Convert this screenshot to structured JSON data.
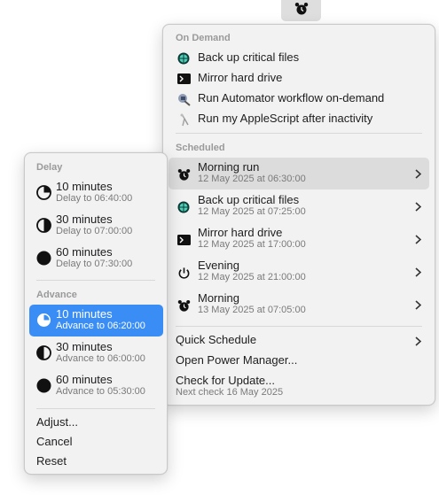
{
  "menubar": {
    "icon": "alarm-clock-icon"
  },
  "main_menu": {
    "on_demand": {
      "header": "On Demand",
      "items": [
        {
          "label": "Back up critical files",
          "icon": "globe-icon"
        },
        {
          "label": "Mirror hard drive",
          "icon": "terminal-icon"
        },
        {
          "label": "Run Automator workflow on-demand",
          "icon": "automator-icon"
        },
        {
          "label": "Run my AppleScript after inactivity",
          "icon": "applescript-icon"
        }
      ]
    },
    "scheduled": {
      "header": "Scheduled",
      "items": [
        {
          "label": "Morning run",
          "sub": "12 May 2025 at 06:30:00",
          "icon": "alarm-clock-icon"
        },
        {
          "label": "Back up critical files",
          "sub": "12 May 2025 at 07:25:00",
          "icon": "globe-icon"
        },
        {
          "label": "Mirror hard drive",
          "sub": "12 May 2025 at 17:00:00",
          "icon": "terminal-icon"
        },
        {
          "label": "Evening",
          "sub": "12 May 2025 at 21:00:00",
          "icon": "power-icon"
        },
        {
          "label": "Morning",
          "sub": "13 May 2025 at 07:05:00",
          "icon": "alarm-clock-icon"
        }
      ]
    },
    "footer": {
      "quick_schedule": "Quick Schedule",
      "open_power_manager": "Open Power Manager...",
      "check_update": "Check for Update...",
      "next_check": "Next check 16 May 2025"
    }
  },
  "sub_menu": {
    "delay": {
      "header": "Delay",
      "items": [
        {
          "label": "10 minutes",
          "sub": "Delay to 06:40:00",
          "icon": "clock-quarter-icon"
        },
        {
          "label": "30 minutes",
          "sub": "Delay to 07:00:00",
          "icon": "clock-half-icon"
        },
        {
          "label": "60 minutes",
          "sub": "Delay to 07:30:00",
          "icon": "clock-full-icon"
        }
      ]
    },
    "advance": {
      "header": "Advance",
      "items": [
        {
          "label": "10 minutes",
          "sub": "Advance to 06:20:00",
          "icon": "clock-quarter-icon",
          "selected": true
        },
        {
          "label": "30 minutes",
          "sub": "Advance to 06:00:00",
          "icon": "clock-half-icon"
        },
        {
          "label": "60 minutes",
          "sub": "Advance to 05:30:00",
          "icon": "clock-full-icon"
        }
      ]
    },
    "footer": {
      "adjust": "Adjust...",
      "cancel": "Cancel",
      "reset": "Reset"
    }
  },
  "colors": {
    "selection": "#3a8df5",
    "highlight": "#dcdcdc",
    "menu_bg": "#f2f2f2"
  }
}
